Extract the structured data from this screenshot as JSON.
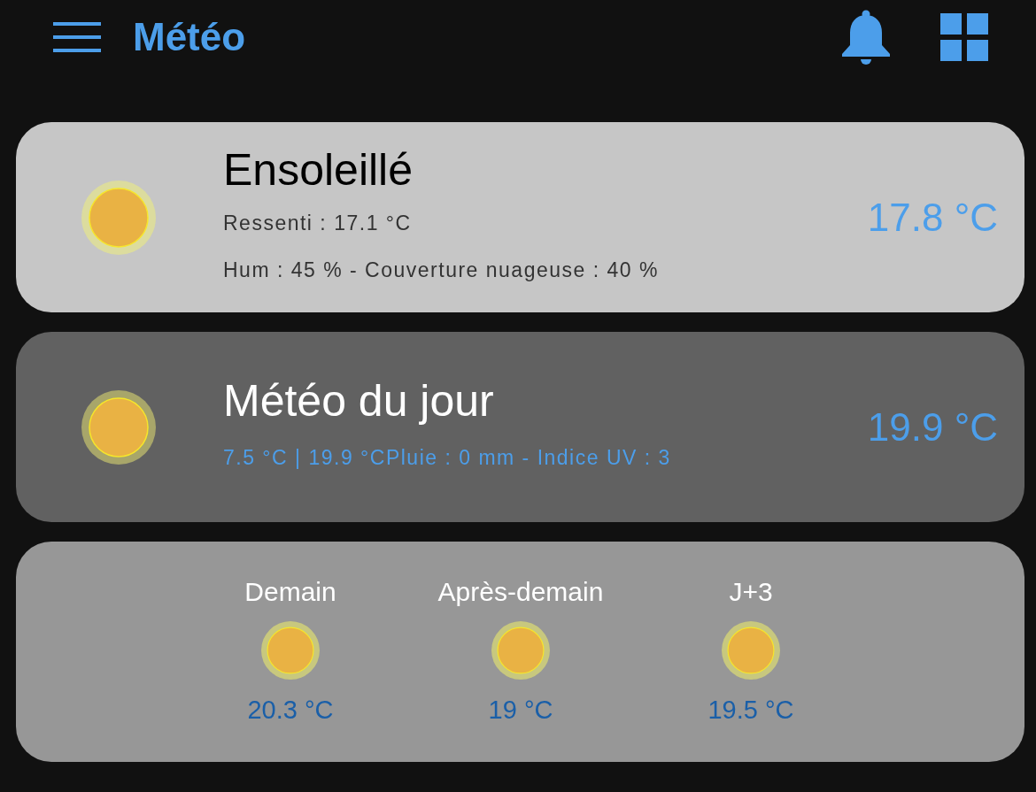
{
  "header": {
    "title": "Météo"
  },
  "current": {
    "condition": "Ensoleillé",
    "feels_like": "Ressenti : 17.1 °C",
    "details": "Hum : 45 % - Couverture nuageuse : 40 %",
    "temperature": "17.8 °C"
  },
  "today": {
    "title": "Météo du jour",
    "summary": "7.5 °C | 19.9 °CPluie : 0 mm - Indice UV : 3",
    "temperature": "19.9 °C"
  },
  "forecast": [
    {
      "day": "Demain",
      "temperature": "20.3 °C"
    },
    {
      "day": "Après-demain",
      "temperature": "19 °C"
    },
    {
      "day": "J+3",
      "temperature": "19.5 °C"
    }
  ]
}
